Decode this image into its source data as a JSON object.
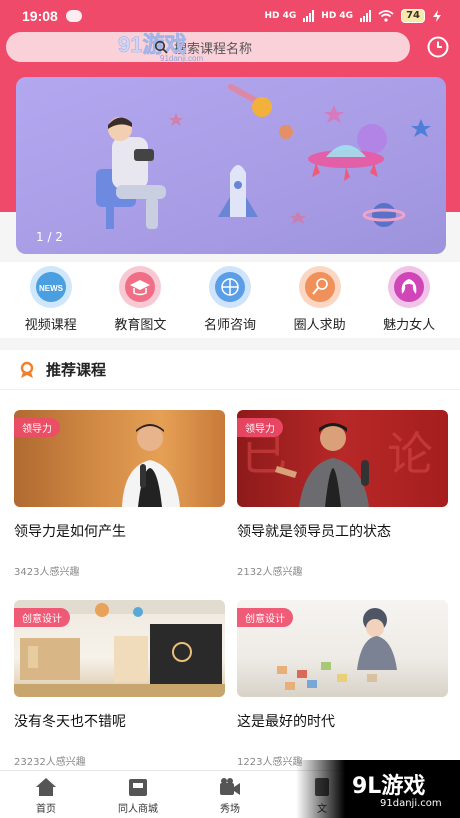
{
  "status_bar": {
    "time": "19:08",
    "battery": "74",
    "net1": "HD 4G",
    "net2": "HD 4G"
  },
  "search": {
    "placeholder": "搜索课程名称"
  },
  "watermark": {
    "brand": "91游戏",
    "site": "91danji.com"
  },
  "banner": {
    "pager": "1 / 2"
  },
  "nav": [
    {
      "label": "视频课程",
      "icon": "news-icon",
      "color": "#4a9fe0"
    },
    {
      "label": "教育图文",
      "icon": "graduation-cap-icon",
      "color": "#f06f86"
    },
    {
      "label": "名师咨询",
      "icon": "basketball-icon",
      "color": "#5a9ee8"
    },
    {
      "label": "圈人求助",
      "icon": "microphone-icon",
      "color": "#f0905a"
    },
    {
      "label": "魅力女人",
      "icon": "woman-icon",
      "color": "#d046b8"
    }
  ],
  "section": {
    "title": "推荐课程"
  },
  "cards": [
    {
      "tag": "领导力",
      "title": "领导力是如何产生",
      "count": "3423人感兴趣"
    },
    {
      "tag": "领导力",
      "title": "领导就是领导员工的状态",
      "count": "2132人感兴趣"
    },
    {
      "tag": "创意设计",
      "title": "没有冬天也不错呢",
      "count": "23232人感兴趣"
    },
    {
      "tag": "创意设计",
      "title": "这是最好的时代",
      "count": "1223人感兴趣"
    }
  ],
  "tabs": [
    {
      "label": "首页",
      "icon": "home-icon"
    },
    {
      "label": "同人商城",
      "icon": "shop-icon"
    },
    {
      "label": "秀场",
      "icon": "camera-icon"
    },
    {
      "label": "文",
      "icon": "doc-icon"
    },
    {
      "label": "",
      "icon": "user-icon"
    }
  ],
  "badge": {
    "big": "9L游戏",
    "small": "91danji.com"
  },
  "colors": {
    "brand": "#f04a6a",
    "tag": "#f04a6a"
  }
}
